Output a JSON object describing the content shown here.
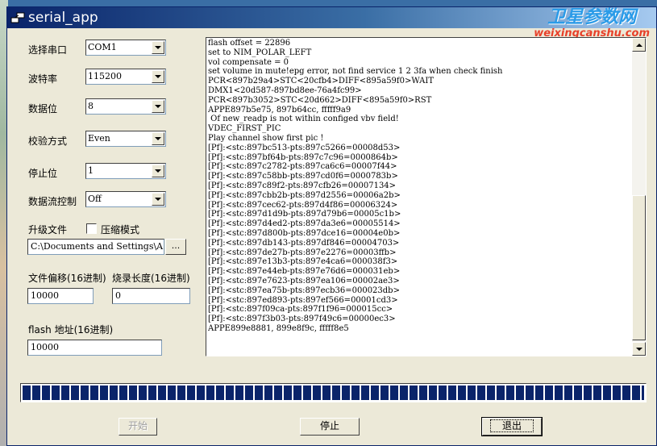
{
  "window": {
    "title": "serial_app",
    "watermark_cn": "卫星参数网",
    "watermark_url": "weixingcanshu.com"
  },
  "form": {
    "port": {
      "label": "选择串口",
      "value": "COM1"
    },
    "baud": {
      "label": "波特率",
      "value": "115200"
    },
    "databits": {
      "label": "数据位",
      "value": "8"
    },
    "parity": {
      "label": "校验方式",
      "value": "Even"
    },
    "stopbits": {
      "label": "停止位",
      "value": "1"
    },
    "flow": {
      "label": "数据流控制",
      "value": "Off"
    },
    "upgrade_file_label": "升级文件",
    "compress_label": "压缩模式",
    "compress_checked": false,
    "file_path": "C:\\Documents and Settings\\A",
    "browse_label": "...",
    "offset": {
      "label": "文件偏移(16进制)",
      "value": "10000"
    },
    "burn_length": {
      "label": "烧录长度(16进制)",
      "value": "0"
    },
    "flash_addr": {
      "label": "flash 地址(16进制)",
      "value": "10000"
    }
  },
  "log": {
    "lines": [
      "flash offset = 22896",
      "set to NIM_POLAR_LEFT",
      "vol compensate = 0",
      "set volume in mute!epg error, not find service 1 2 3fa when check finish",
      "PCR<897b29a4>STC<20cfb4>DIFF<895a59f0>WAIT",
      "DMX1<20d587-897bd8ee-76a4fc99>",
      "PCR<897b3052>STC<20d662>DIFF<895a59f0>RST",
      "APPE897b5e75, 897b64cc, fffff9a9",
      " Of new_readp is not within configed vbv field!",
      "VDEC_FIRST_PIC",
      "Play channel show first pic !",
      "[Pf]:<stc:897bc513-pts:897c5266=00008d53>",
      "[Pf]:<stc:897bf64b-pts:897c7c96=0000864b>",
      "[Pf]:<stc:897c2782-pts:897ca6c6=00007f44>",
      "[Pf]:<stc:897c58bb-pts:897cd0f6=0000783b>",
      "[Pf]:<stc:897c89f2-pts:897cfb26=00007134>",
      "[Pf]:<stc:897cbb2b-pts:897d2556=00006a2b>",
      "[Pf]:<stc:897cec62-pts:897d4f86=00006324>",
      "[Pf]:<stc:897d1d9b-pts:897d79b6=00005c1b>",
      "[Pf]:<stc:897d4ed2-pts:897da3e6=00005514>",
      "[Pf]:<stc:897d800b-pts:897dce16=00004e0b>",
      "[Pf]:<stc:897db143-pts:897df846=00004703>",
      "[Pf]:<stc:897de27b-pts:897e2276=00003ffb>",
      "[Pf]:<stc:897e13b3-pts:897e4ca6=000038f3>",
      "[Pf]:<stc:897e44eb-pts:897e76d6=000031eb>",
      "[Pf]:<stc:897e7623-pts:897ea106=00002ae3>",
      "[Pf]:<stc:897ea75b-pts:897ecb36=000023db>",
      "[Pf]:<stc:897ed893-pts:897ef566=00001cd3>",
      "[Pf]:<stc:897f09ca-pts:897f1f96=000015cc>",
      "[Pf]:<stc:897f3b03-pts:897f49c6=00000ec3>",
      "APPE899e8881, 899e8f9c, fffff8e5"
    ]
  },
  "progress": {
    "fraction": 1.0
  },
  "buttons": {
    "start": "开始",
    "stop": "停止",
    "exit": "退出"
  }
}
